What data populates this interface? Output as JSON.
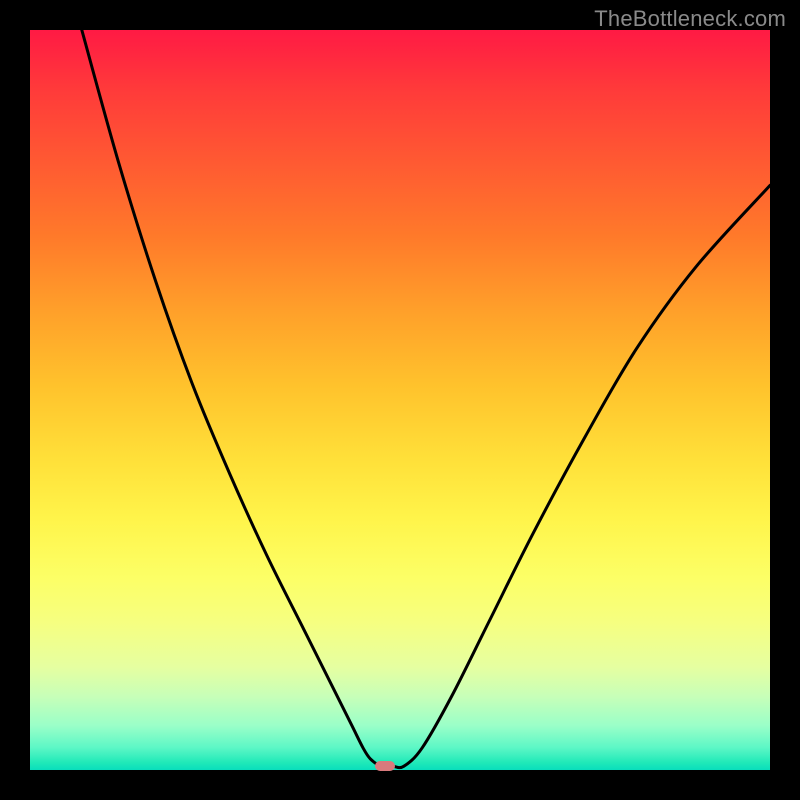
{
  "watermark": "TheBottleneck.com",
  "chart_data": {
    "type": "line",
    "title": "",
    "xlabel": "",
    "ylabel": "",
    "xlim": [
      0,
      100
    ],
    "ylim": [
      0,
      100
    ],
    "grid": false,
    "legend": false,
    "series": [
      {
        "name": "curve",
        "x": [
          7,
          12,
          17,
          22,
          27,
          32,
          37,
          41,
          43.5,
          45,
          46,
          47.5,
          49,
          50.5,
          53,
          57,
          62,
          68,
          75,
          82,
          90,
          100
        ],
        "y": [
          100,
          82,
          66,
          52,
          40,
          29,
          19,
          11,
          6,
          3,
          1.5,
          0.5,
          0.5,
          0.5,
          3,
          10,
          20,
          32,
          45,
          57,
          68,
          79
        ]
      }
    ],
    "marker": {
      "x": 48,
      "y": 0.5,
      "color": "#d97a7d"
    },
    "background_gradient": {
      "top": "#ff1a44",
      "bottom": "#08debc"
    }
  }
}
